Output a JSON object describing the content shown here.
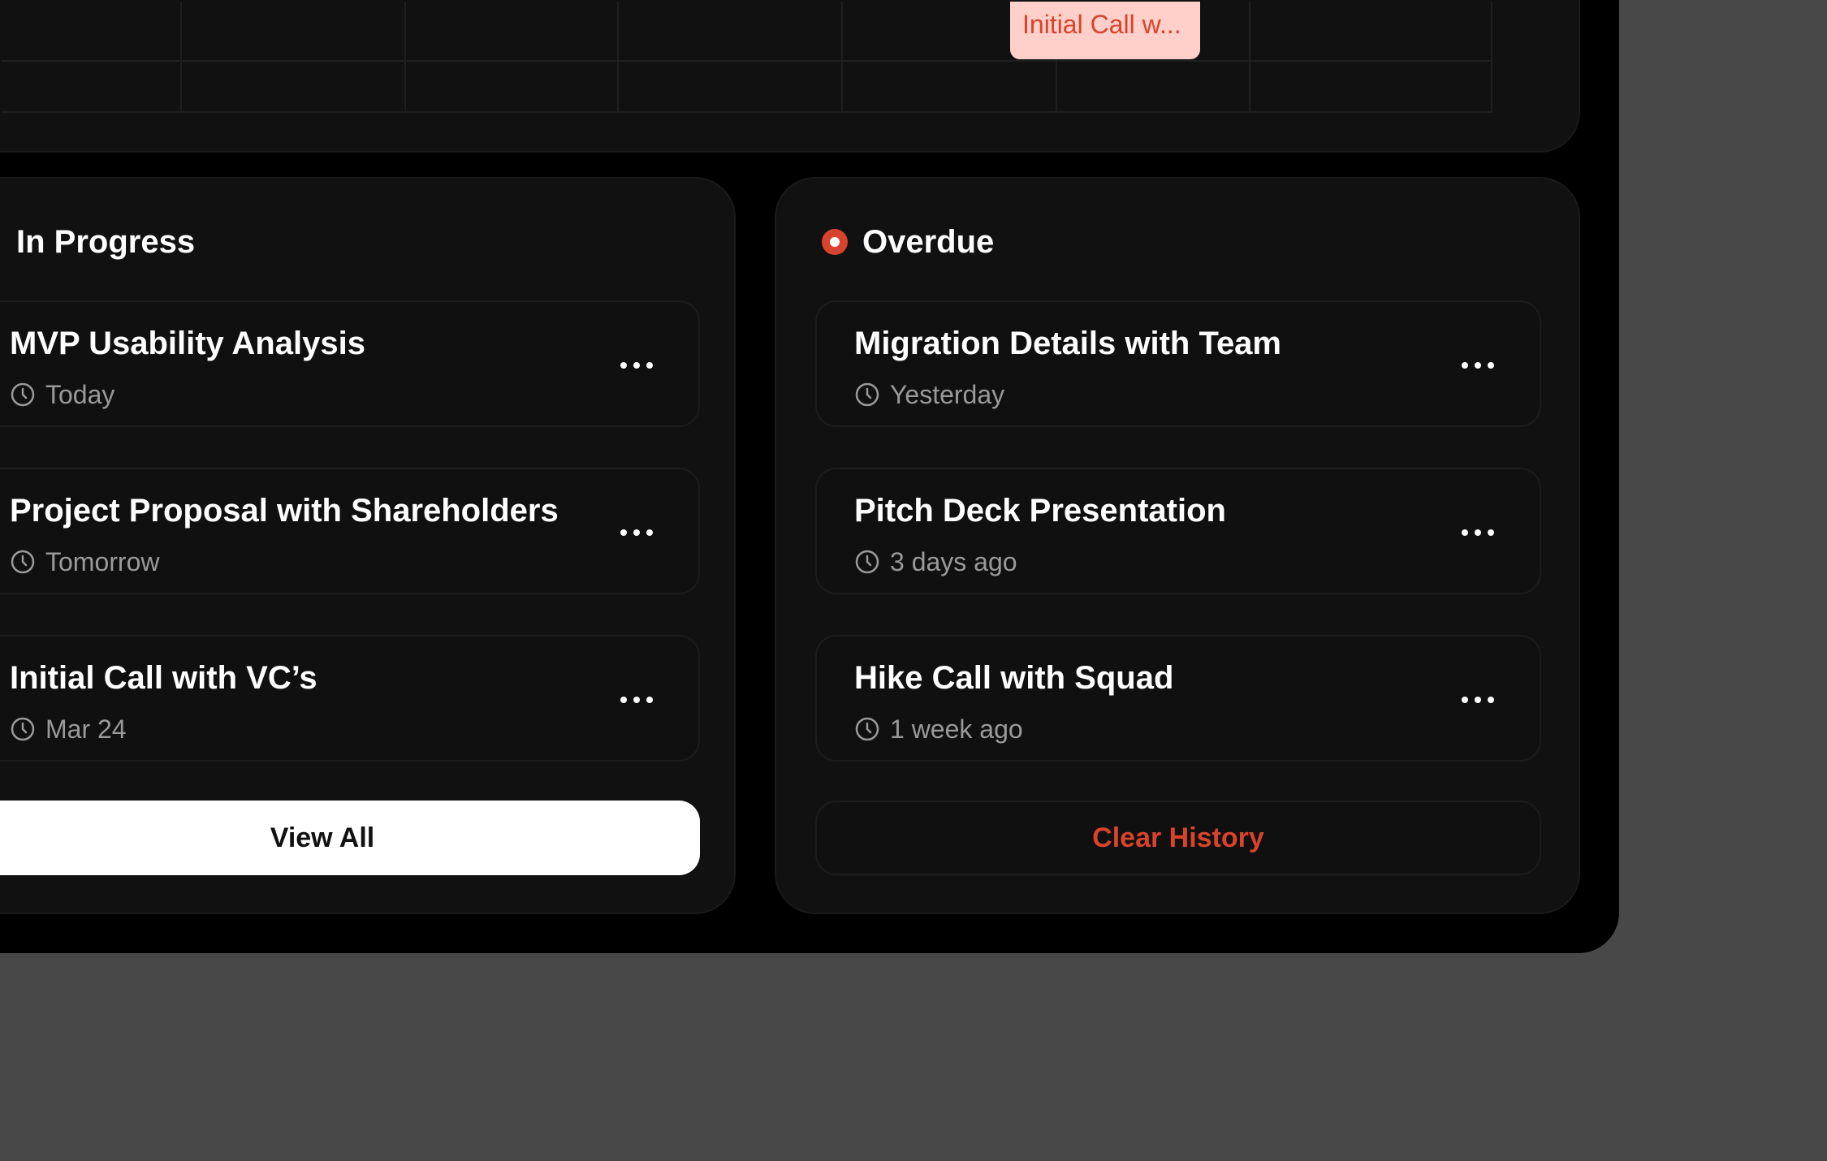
{
  "colors": {
    "accent": "#d8432d",
    "chip_bg": "#ffd0c9",
    "panel_bg": "#111111",
    "app_bg": "#000000",
    "backdrop": "#484848"
  },
  "calendar": {
    "event_chip": "Initial Call w..."
  },
  "in_progress": {
    "title": "In Progress",
    "tasks": [
      {
        "title": "MVP Usability Analysis",
        "when": "Today"
      },
      {
        "title": "Project Proposal with Shareholders",
        "when": "Tomorrow"
      },
      {
        "title": "Initial Call with VC’s",
        "when": "Mar 24"
      }
    ],
    "view_all_label": "View All"
  },
  "overdue": {
    "title": "Overdue",
    "tasks": [
      {
        "title": "Migration Details with Team",
        "when": "Yesterday"
      },
      {
        "title": "Pitch Deck Presentation",
        "when": "3 days ago"
      },
      {
        "title": "Hike Call with Squad",
        "when": "1 week ago"
      }
    ],
    "clear_label": "Clear History"
  },
  "icons": {
    "clock": "clock-icon",
    "more": "more-horizontal-icon",
    "status": "status-dot-icon"
  }
}
